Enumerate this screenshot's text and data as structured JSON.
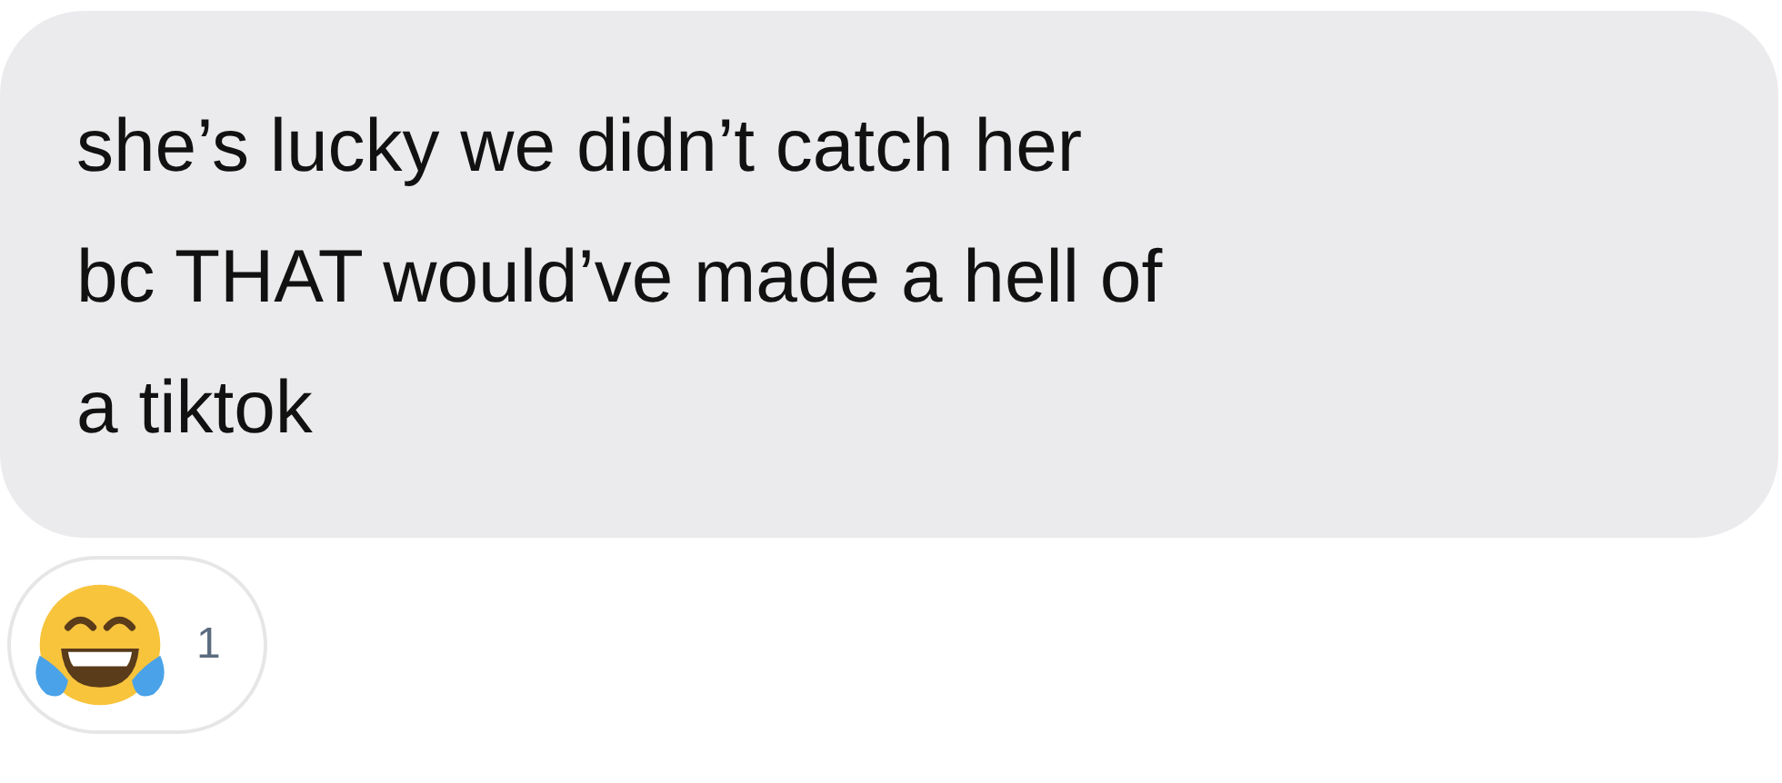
{
  "message": {
    "lines": [
      "she’s lucky we didn’t catch her",
      "bc THAT would’ve made a hell of",
      "a tiktok"
    ]
  },
  "reactions": [
    {
      "count": "1"
    }
  ]
}
